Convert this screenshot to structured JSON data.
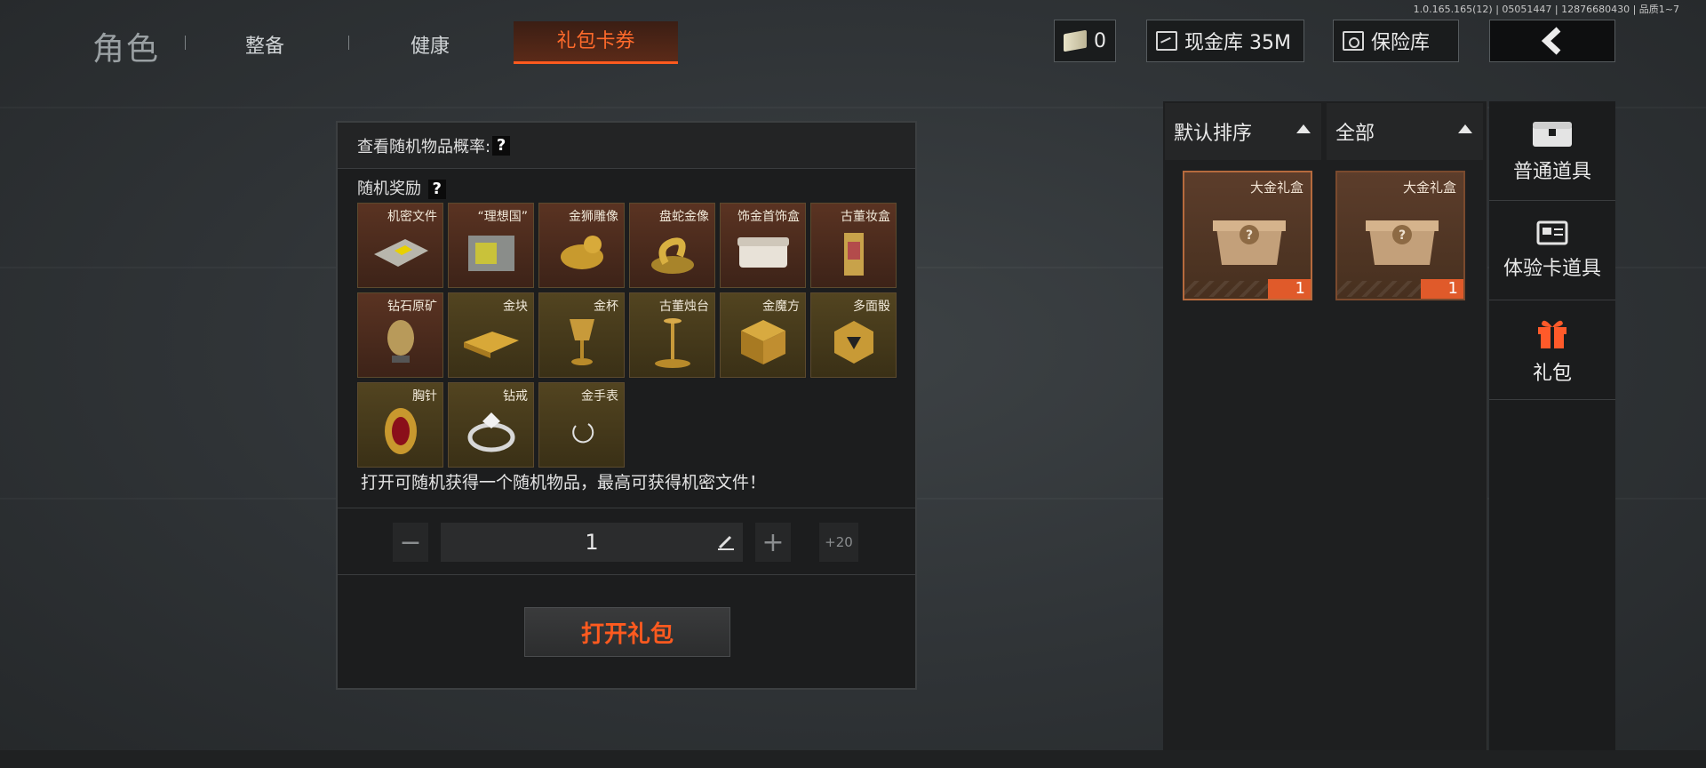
{
  "version": "1.0.165.165(12) | 05051447 | 12876680430 | 品质1~7",
  "nav": {
    "role": "角色",
    "tabs": [
      {
        "label": "整备"
      },
      {
        "label": "健康"
      },
      {
        "label": "礼包卡券"
      }
    ]
  },
  "hud": {
    "tickets": "0",
    "cash_label": "现金库 35M",
    "safe_label": "保险库",
    "back_icon": "back-arrow-icon"
  },
  "panel": {
    "probability_label": "查看随机物品概率:",
    "help_mark": "?",
    "rewards_label": "随机奖励",
    "items": [
      {
        "name": "机密文件",
        "bg": "red"
      },
      {
        "name": "“理想国”",
        "bg": "red"
      },
      {
        "name": "金狮雕像",
        "bg": "red"
      },
      {
        "name": "盘蛇金像",
        "bg": "red"
      },
      {
        "name": "饰金首饰盒",
        "bg": "red"
      },
      {
        "name": "古董妆盒",
        "bg": "red"
      },
      {
        "name": "钻石原矿",
        "bg": "red"
      },
      {
        "name": "金块",
        "bg": "gold"
      },
      {
        "name": "金杯",
        "bg": "gold"
      },
      {
        "name": "古董烛台",
        "bg": "gold"
      },
      {
        "name": "金魔方",
        "bg": "gold"
      },
      {
        "name": "多面骰",
        "bg": "gold"
      },
      {
        "name": "胸针",
        "bg": "gold"
      },
      {
        "name": "钻戒",
        "bg": "gold"
      },
      {
        "name": "金手表",
        "bg": "gold"
      }
    ],
    "description": "打开可随机获得一个随机物品，最高可获得机密文件！",
    "quantity": "1",
    "minus": "−",
    "plus": "+",
    "plus20": "+20",
    "open_button": "打开礼包"
  },
  "inventory": {
    "sort_label": "默认排序",
    "filter_label": "全部",
    "items": [
      {
        "name": "大金礼盒",
        "count": "1"
      },
      {
        "name": "大金礼盒",
        "count": "1"
      }
    ]
  },
  "side_nav": [
    {
      "label": "普通道具",
      "icon": "chest-icon"
    },
    {
      "label": "体验卡道具",
      "icon": "card-icon"
    },
    {
      "label": "礼包",
      "icon": "gift-icon"
    }
  ],
  "colors": {
    "accent": "#ff5a1f",
    "gift": "#ff5a2a"
  }
}
